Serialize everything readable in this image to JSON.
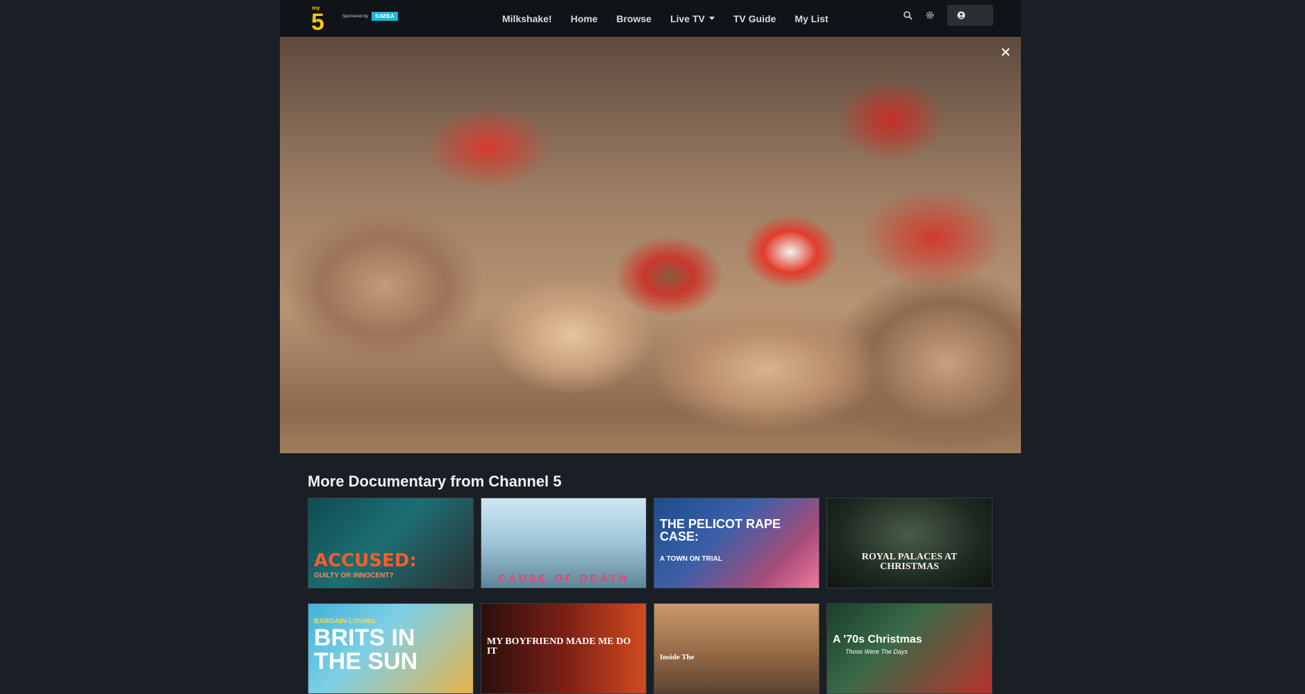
{
  "header": {
    "logo_text": "my5",
    "sponsor_label": "Sponsored by",
    "sponsor_name": "SIMBA",
    "nav": [
      {
        "label": "Milkshake!"
      },
      {
        "label": "Home"
      },
      {
        "label": "Browse"
      },
      {
        "label": "Live TV"
      },
      {
        "label": "TV Guide"
      },
      {
        "label": "My List"
      }
    ],
    "icons": [
      "search-icon",
      "settings-icon",
      "account-icon"
    ]
  },
  "hero": {
    "close_icon": "close-icon"
  },
  "section": {
    "title": "More Documentary from Channel 5"
  },
  "cards": [
    {
      "title": "ACCUSED:",
      "subtitle": "GUILTY OR INNOCENT?"
    },
    {
      "title": "CAUSE OF DEATH"
    },
    {
      "title": "THE PELICOT RAPE CASE:",
      "subtitle": "A TOWN ON TRIAL"
    },
    {
      "title": "ROYAL PALACES AT CHRISTMAS"
    },
    {
      "title": "BRITS IN THE SUN",
      "kicker": "BARGAIN-LOVING"
    },
    {
      "title": "MY BOYFRIEND MADE ME DO IT"
    },
    {
      "title": "Inside The"
    },
    {
      "title": "A '70s Christmas",
      "subtitle": "Those Were The Days"
    }
  ],
  "colors": {
    "background": "#1a1f26",
    "header_bg": "#101318",
    "brand_yellow": "#f5c518",
    "sponsor_teal": "#19b6d6"
  }
}
